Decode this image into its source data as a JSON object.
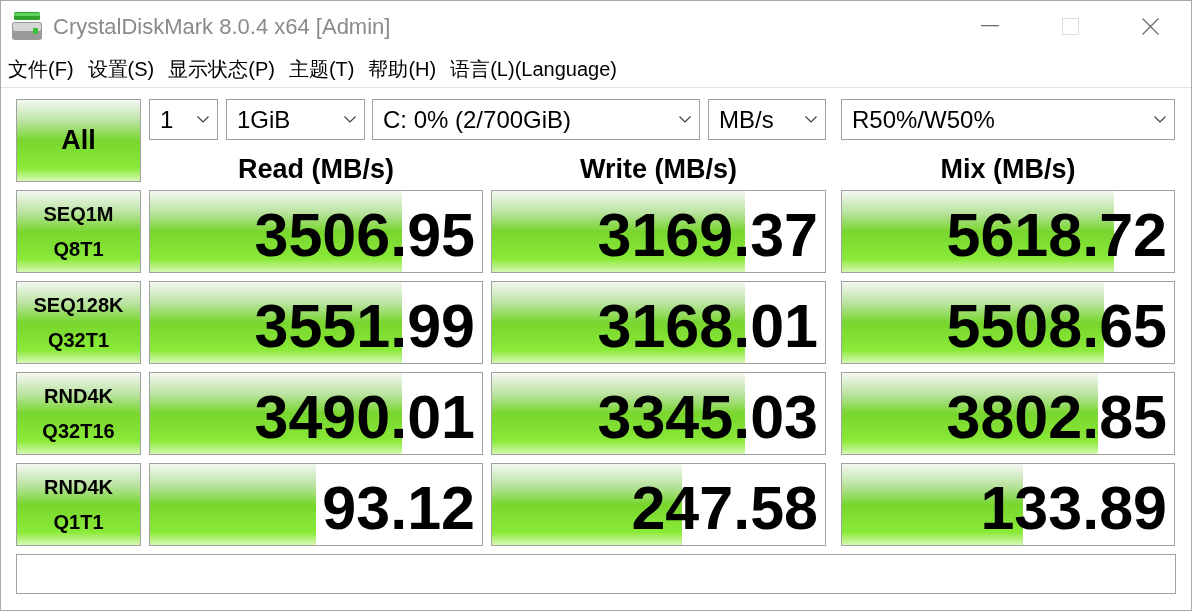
{
  "window": {
    "title": "CrystalDiskMark 8.0.4 x64 [Admin]",
    "controls": [
      {
        "kind": "minimize",
        "disabled": false
      },
      {
        "kind": "maximize",
        "disabled": true
      },
      {
        "kind": "close",
        "disabled": false
      }
    ]
  },
  "menu": [
    "文件(F)",
    "设置(S)",
    "显示状态(P)",
    "主题(T)",
    "帮助(H)",
    "语言(L)(Language)"
  ],
  "all_button": "All",
  "selects": [
    {
      "value": "1"
    },
    {
      "value": "1GiB"
    },
    {
      "value": "C: 0% (2/700GiB)"
    },
    {
      "value": "MB/s"
    },
    {
      "value": "R50%/W50%"
    }
  ],
  "columns": [
    "Read (MB/s)",
    "Write (MB/s)",
    "Mix (MB/s)"
  ],
  "rows": [
    {
      "label_lines": [
        "SEQ1M",
        "Q8T1"
      ],
      "results": [
        {
          "value": "3506.95",
          "level": 0.76
        },
        {
          "value": "3169.37",
          "level": 0.76
        },
        {
          "value": "5618.72",
          "level": 0.82
        }
      ]
    },
    {
      "label_lines": [
        "SEQ128K",
        "Q32T1"
      ],
      "results": [
        {
          "value": "3551.99",
          "level": 0.76
        },
        {
          "value": "3168.01",
          "level": 0.76
        },
        {
          "value": "5508.65",
          "level": 0.79
        }
      ]
    },
    {
      "label_lines": [
        "RND4K",
        "Q32T16"
      ],
      "results": [
        {
          "value": "3490.01",
          "level": 0.76
        },
        {
          "value": "3345.03",
          "level": 0.76
        },
        {
          "value": "3802.85",
          "level": 0.77
        }
      ]
    },
    {
      "label_lines": [
        "RND4K",
        "Q1T1"
      ],
      "results": [
        {
          "value": "93.12",
          "level": 0.5
        },
        {
          "value": "247.58",
          "level": 0.57
        },
        {
          "value": "133.89",
          "level": 0.545
        }
      ]
    }
  ]
}
